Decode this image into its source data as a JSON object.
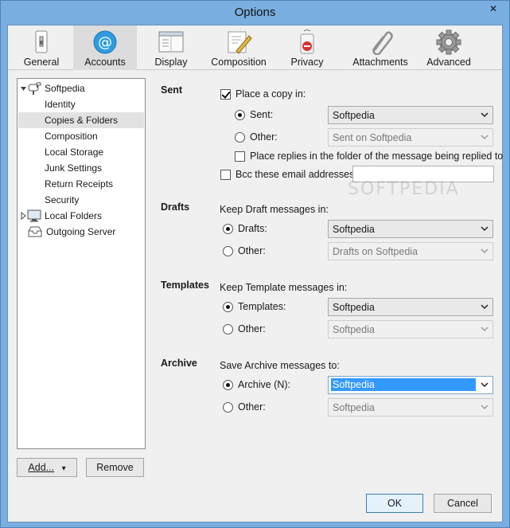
{
  "window": {
    "title": "Options",
    "close_glyph": "✕"
  },
  "toolbar": {
    "items": [
      {
        "label": "General",
        "icon": "general-switch-icon"
      },
      {
        "label": "Accounts",
        "icon": "at-sign-icon"
      },
      {
        "label": "Display",
        "icon": "display-window-icon"
      },
      {
        "label": "Composition",
        "icon": "compose-pen-icon"
      },
      {
        "label": "Privacy",
        "icon": "privacy-sign-icon"
      },
      {
        "label": "Attachments",
        "icon": "paperclip-icon"
      },
      {
        "label": "Advanced",
        "icon": "gear-icon"
      }
    ],
    "selected": "Accounts"
  },
  "tree": {
    "account": "Softpedia",
    "items": [
      "Identity",
      "Copies & Folders",
      "Composition",
      "Local Storage",
      "Junk Settings",
      "Return Receipts",
      "Security"
    ],
    "selected": "Copies & Folders",
    "local_folders": "Local Folders",
    "outgoing_server": "Outgoing Server"
  },
  "tree_buttons": {
    "add_label": "Add...",
    "add_arrow": "▾",
    "remove_label": "Remove"
  },
  "sent": {
    "heading": "Sent",
    "place_copy_label": "Place a copy in:",
    "sent_radio_label": "Sent:",
    "sent_value": "Softpedia",
    "other_radio_label": "Other:",
    "other_value": "Sent on Softpedia",
    "replies_label": "Place replies in the folder of the message being replied to",
    "bcc_label": "Bcc these email addresses:",
    "bcc_value": ""
  },
  "drafts": {
    "heading": "Drafts",
    "keep_label": "Keep Draft messages in:",
    "drafts_radio_label": "Drafts:",
    "drafts_value": "Softpedia",
    "other_radio_label": "Other:",
    "other_value": "Drafts on Softpedia"
  },
  "templates": {
    "heading": "Templates",
    "keep_label": "Keep Template messages in:",
    "templates_radio_label": "Templates:",
    "templates_value": "Softpedia",
    "other_radio_label": "Other:",
    "other_value": "Softpedia"
  },
  "archive": {
    "heading": "Archive",
    "save_label": "Save Archive messages to:",
    "archive_radio_label": "Archive (N):",
    "archive_value": "Softpedia",
    "other_radio_label": "Other:",
    "other_value": "Softpedia"
  },
  "dialog_buttons": {
    "ok_label": "OK",
    "cancel_label": "Cancel"
  },
  "watermark": "SOFTPEDIA",
  "colors": {
    "accent_blue": "#3399ff",
    "title_bar": "#79aee0",
    "at_icon": "#2e9be0"
  }
}
